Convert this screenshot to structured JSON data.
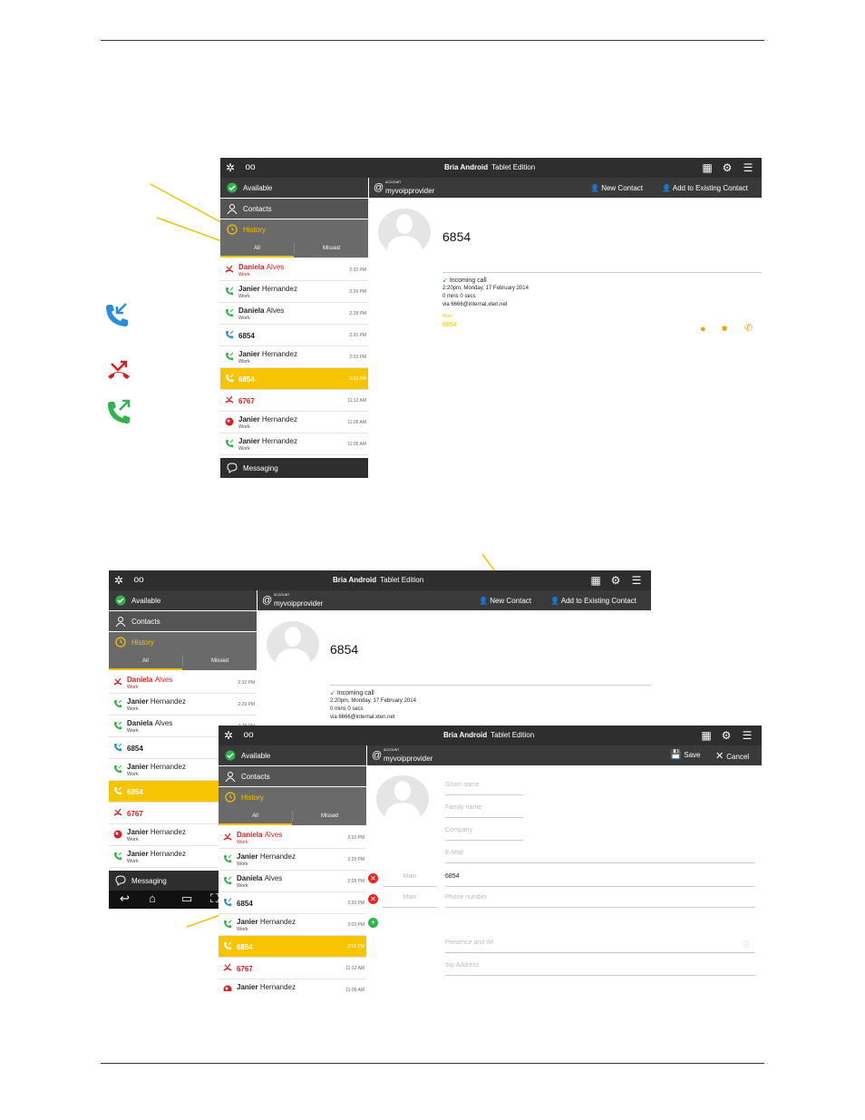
{
  "app": {
    "title_bold": "Bria Android",
    "title_light": "Tablet Edition"
  },
  "sidebar": {
    "available": "Available",
    "contacts": "Contacts",
    "history": "History",
    "messaging": "Messaging"
  },
  "tabs": {
    "all": "All",
    "missed": "Missed"
  },
  "account": {
    "label": "ACCOUNT",
    "provider": "myvoipprovider"
  },
  "actions": {
    "new_contact": "New Contact",
    "add_existing": "Add to Existing Contact",
    "save": "Save",
    "cancel": "Cancel"
  },
  "history": [
    {
      "name": "Daniela",
      "name2": "Alves",
      "sub": "Work",
      "time": "2:32 PM",
      "type": "missed"
    },
    {
      "name": "Janier",
      "name2": "Hernandez",
      "sub": "Work",
      "time": "2:29 PM",
      "type": "outgoing"
    },
    {
      "name": "Daniela",
      "name2": "Alves",
      "sub": "Work",
      "time": "2:28 PM",
      "type": "outgoing"
    },
    {
      "name": "6854",
      "name2": "",
      "sub": "",
      "time": "2:20 PM",
      "type": "incoming"
    },
    {
      "name": "Janier",
      "name2": "Hernandez",
      "sub": "Work",
      "time": "2:03 PM",
      "type": "outgoing"
    },
    {
      "name": "6854",
      "name2": "",
      "sub": "",
      "time": "2:02 PM",
      "type": "selected"
    },
    {
      "name": "6767",
      "name2": "",
      "sub": "",
      "time": "11:12 AM",
      "type": "missed"
    },
    {
      "name": "Janier",
      "name2": "Hernandez",
      "sub": "Work",
      "time": "11:05 AM",
      "type": "avatar"
    },
    {
      "name": "Janier",
      "name2": "Hernandez",
      "sub": "Work",
      "time": "11:05 AM",
      "type": "outgoing"
    }
  ],
  "detail": {
    "number": "6854",
    "call_type": "Incoming call",
    "when": "2:20pm, Monday, 17 February 2014",
    "duration": "0 mins 0 secs",
    "via": "via 6666@internal.xten.net",
    "phone_label": "Main",
    "phone_value": "6854"
  },
  "form": {
    "given": "Given name",
    "family": "Family name",
    "company": "Company",
    "email": "E-Mail",
    "main": "Main",
    "phone_value": "6854",
    "phone_placeholder": "Phone number",
    "presence": "Presence and IM",
    "sip": "Sip Address"
  },
  "colors": {
    "accent": "#f2c200",
    "missed": "#d62020",
    "incoming": "#2a8ddc",
    "outgoing": "#2fb34a",
    "dark": "#2e2e2e"
  }
}
